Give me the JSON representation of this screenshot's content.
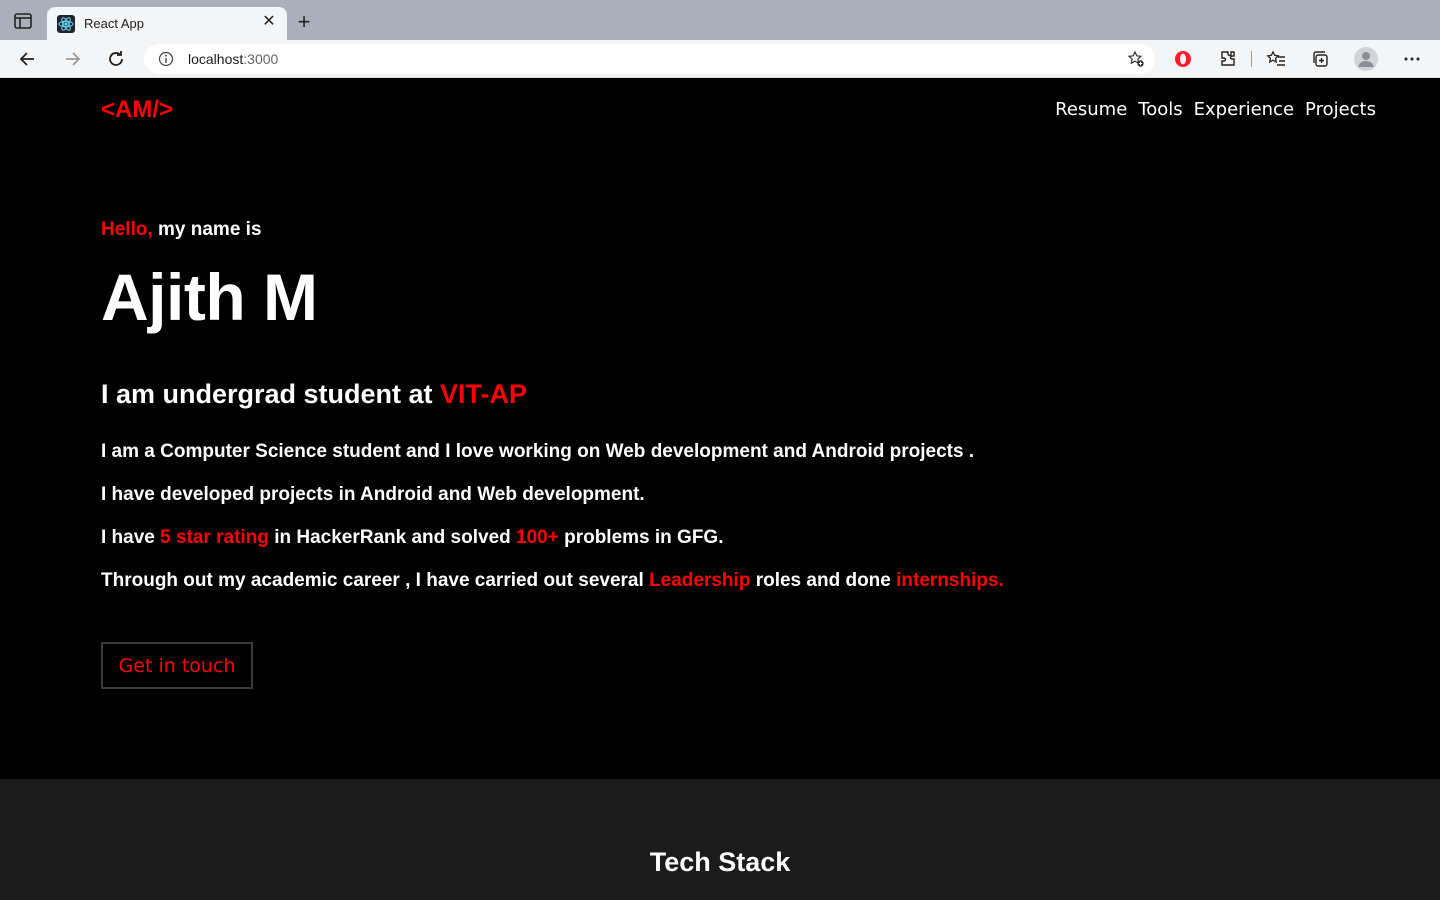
{
  "browser": {
    "tab_title": "React App",
    "url_host": "localhost",
    "url_port": ":3000"
  },
  "header": {
    "logo": "<AM/>",
    "nav": [
      "Resume",
      "Tools",
      "Experience",
      "Projects"
    ]
  },
  "hero": {
    "greeting_red": "Hello,",
    "greeting_rest": " my name is",
    "name": "Ajith M",
    "subtitle_prefix": "I am undergrad student at ",
    "subtitle_highlight": "VIT-AP",
    "para1": "I am a Computer Science student and I love working on Web development and Android projects .",
    "para2": "I have developed projects in Android and Web development.",
    "para3": {
      "a": "I have ",
      "b": "5 star rating",
      "c": " in HackerRank and solved ",
      "d": "100+",
      "e": " problems in GFG."
    },
    "para4": {
      "a": "Through out my academic career , I have carried out several ",
      "b": "Leadership",
      "c": " roles and done ",
      "d": "internships."
    },
    "cta_label": "Get in touch"
  },
  "tech": {
    "title": "Tech Stack"
  },
  "colors": {
    "accent": "#ff0000",
    "background": "#000000",
    "section_bg": "#1b1b1b"
  }
}
